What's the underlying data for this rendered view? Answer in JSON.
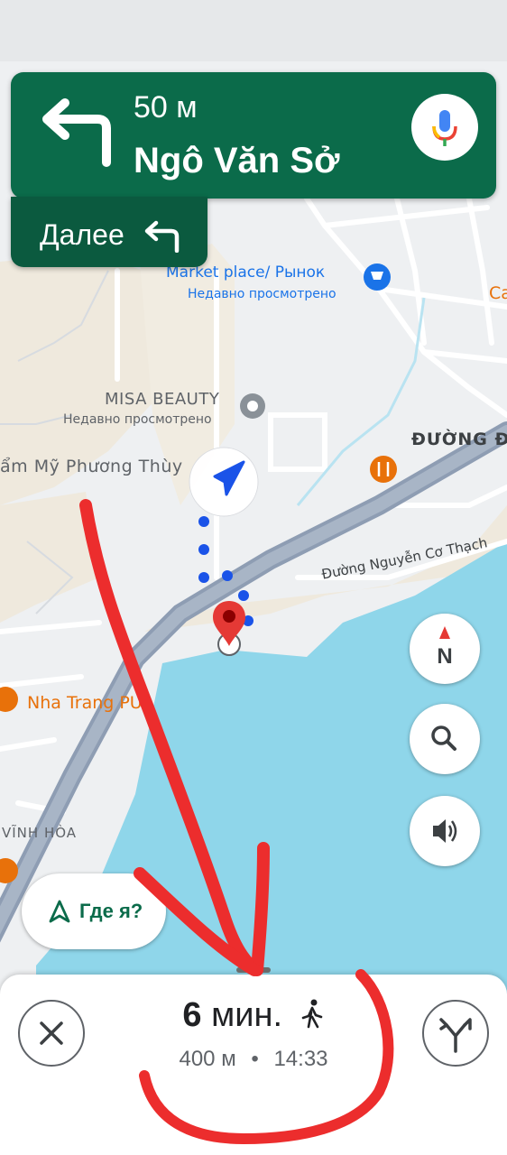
{
  "navigation": {
    "distance": "50 м",
    "street": "Ngô Văn Sở",
    "then_label": "Далее"
  },
  "map": {
    "poi": [
      {
        "name": "Market place/ Рынок",
        "sub": "Недавно просмотрено"
      },
      {
        "name": "MISA BEAUTY",
        "sub": "Недавно просмотрено"
      },
      {
        "name": "ẩm Mỹ Phương Thùy"
      },
      {
        "name": "Nha Trang PU"
      },
      {
        "name": "Ca"
      }
    ],
    "streets": {
      "duong_label": "ĐƯỜNG Đ",
      "nguyen_co_thach": "Đường Nguyễn Cơ Thạch",
      "vinh_hoa": "VĨNH HÒA"
    }
  },
  "controls": {
    "compass_letter": "N",
    "where_am_i": "Где я?"
  },
  "trip": {
    "duration_value": "6",
    "duration_unit": "мин.",
    "distance": "400 м",
    "arrival": "14:33",
    "separator": "•"
  },
  "colors": {
    "nav_green": "#0b6b4a",
    "then_green": "#0b5a3f",
    "water": "#8fd6ea",
    "route_dots": "#1a53e8",
    "scribble": "#ec2d2d"
  },
  "icons": {
    "turn": "turn-left-icon",
    "mic": "microphone-icon",
    "location": "navigation-arrow-icon",
    "destination": "red-pin-icon",
    "walk": "walking-person-icon"
  }
}
